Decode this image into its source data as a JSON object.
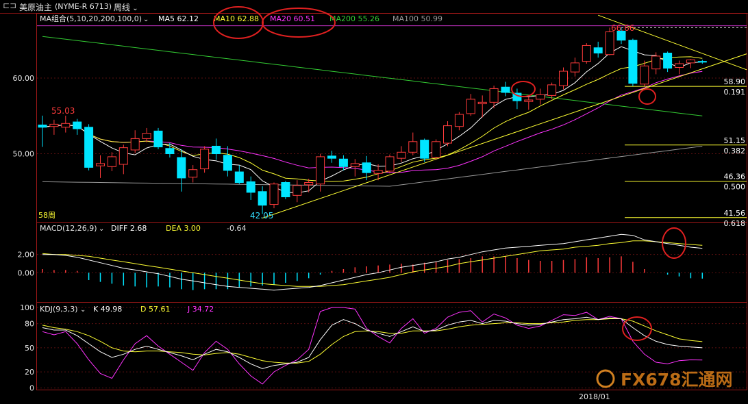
{
  "title": {
    "icon": "split-window-icon",
    "name": "美原油主",
    "code": "(NYME-R 6713)",
    "period": "周线"
  },
  "colors": {
    "up": "#ff3b3b",
    "down": "#00e5ff",
    "ma5": "#ffffff",
    "ma10": "#ffff33",
    "ma20": "#ff33ff",
    "ma200": "#33cc33",
    "ma100": "#999999",
    "frame": "#a01818"
  },
  "legend": {
    "ma_group": "MA组合(5,10,20,200,100,0)",
    "ma5": "MA5 62.12",
    "ma10": "MA10 62.88",
    "ma20": "MA20 60.51",
    "ma200": "MA200 55.26",
    "ma100": "MA100 50.99",
    "macd_group": "MACD(12,26,9)",
    "macd_diff": "DIFF  2.68",
    "macd_dea": "DEA  3.00",
    "macd_val": "-0.64",
    "kdj_group": "KDJ(9,3,3)",
    "kdj_k": "K  49.98",
    "kdj_d": "D  57.61",
    "kdj_j": "J  34.72"
  },
  "annotations": {
    "high": "66.66",
    "first_high": "55.03",
    "low": "42.05",
    "bars": "58周",
    "date": "2018/01"
  },
  "watermark": "FX678汇通网",
  "chart_data": [
    {
      "type": "candlestick",
      "panel": "price",
      "y_ticks": [
        "60.00",
        "50.00"
      ],
      "ylim": [
        41,
        68.5
      ],
      "x_count": 58,
      "candles": [
        {
          "o": 53.8,
          "h": 55.03,
          "l": 50.9,
          "c": 53.5
        },
        {
          "o": 53.6,
          "h": 54.5,
          "l": 52.5,
          "c": 53.9
        },
        {
          "o": 53.5,
          "h": 55.03,
          "l": 52.8,
          "c": 54.0
        },
        {
          "o": 54.2,
          "h": 54.6,
          "l": 52.5,
          "c": 53.3
        },
        {
          "o": 53.5,
          "h": 53.9,
          "l": 47.8,
          "c": 48.2
        },
        {
          "o": 48.4,
          "h": 49.8,
          "l": 46.8,
          "c": 48.7
        },
        {
          "o": 48.3,
          "h": 50.2,
          "l": 47.7,
          "c": 49.6
        },
        {
          "o": 48.6,
          "h": 51.2,
          "l": 47.3,
          "c": 50.8
        },
        {
          "o": 50.5,
          "h": 53.1,
          "l": 50.1,
          "c": 52.0
        },
        {
          "o": 52.0,
          "h": 53.4,
          "l": 51.5,
          "c": 52.7
        },
        {
          "o": 53.0,
          "h": 53.4,
          "l": 50.6,
          "c": 50.9
        },
        {
          "o": 50.7,
          "h": 51.4,
          "l": 49.5,
          "c": 50.0
        },
        {
          "o": 49.5,
          "h": 50.6,
          "l": 45.0,
          "c": 46.8
        },
        {
          "o": 46.9,
          "h": 48.5,
          "l": 46.2,
          "c": 47.9
        },
        {
          "o": 48.0,
          "h": 51.0,
          "l": 47.5,
          "c": 50.6
        },
        {
          "o": 51.0,
          "h": 52.0,
          "l": 49.2,
          "c": 50.0
        },
        {
          "o": 49.8,
          "h": 51.0,
          "l": 47.0,
          "c": 47.8
        },
        {
          "o": 47.6,
          "h": 48.5,
          "l": 46.0,
          "c": 46.2
        },
        {
          "o": 46.3,
          "h": 47.0,
          "l": 43.9,
          "c": 44.9
        },
        {
          "o": 45.0,
          "h": 45.7,
          "l": 42.05,
          "c": 43.2
        },
        {
          "o": 43.3,
          "h": 46.2,
          "l": 42.8,
          "c": 46.0
        },
        {
          "o": 46.2,
          "h": 46.4,
          "l": 44.0,
          "c": 44.3
        },
        {
          "o": 44.5,
          "h": 46.5,
          "l": 43.6,
          "c": 45.8
        },
        {
          "o": 45.9,
          "h": 46.7,
          "l": 44.9,
          "c": 46.2
        },
        {
          "o": 46.0,
          "h": 50.0,
          "l": 45.0,
          "c": 49.6
        },
        {
          "o": 49.7,
          "h": 50.4,
          "l": 48.8,
          "c": 49.4
        },
        {
          "o": 49.3,
          "h": 49.8,
          "l": 47.8,
          "c": 48.3
        },
        {
          "o": 48.3,
          "h": 49.3,
          "l": 47.0,
          "c": 48.7
        },
        {
          "o": 48.8,
          "h": 49.7,
          "l": 46.5,
          "c": 47.5
        },
        {
          "o": 47.4,
          "h": 48.6,
          "l": 46.5,
          "c": 47.8
        },
        {
          "o": 47.7,
          "h": 49.9,
          "l": 47.4,
          "c": 49.6
        },
        {
          "o": 49.4,
          "h": 51.0,
          "l": 48.9,
          "c": 50.2
        },
        {
          "o": 50.2,
          "h": 52.8,
          "l": 49.8,
          "c": 51.6
        },
        {
          "o": 51.8,
          "h": 52.0,
          "l": 48.9,
          "c": 49.4
        },
        {
          "o": 49.5,
          "h": 51.9,
          "l": 49.2,
          "c": 51.6
        },
        {
          "o": 51.4,
          "h": 54.3,
          "l": 51.0,
          "c": 53.7
        },
        {
          "o": 53.6,
          "h": 55.5,
          "l": 53.1,
          "c": 55.2
        },
        {
          "o": 55.3,
          "h": 57.9,
          "l": 55.0,
          "c": 57.2
        },
        {
          "o": 56.6,
          "h": 57.7,
          "l": 54.8,
          "c": 56.8
        },
        {
          "o": 56.8,
          "h": 59.0,
          "l": 56.0,
          "c": 58.6
        },
        {
          "o": 58.8,
          "h": 59.5,
          "l": 57.6,
          "c": 58.1
        },
        {
          "o": 58.0,
          "h": 58.6,
          "l": 55.9,
          "c": 57.0
        },
        {
          "o": 56.9,
          "h": 57.5,
          "l": 55.8,
          "c": 57.1
        },
        {
          "o": 57.2,
          "h": 58.6,
          "l": 56.5,
          "c": 57.8
        },
        {
          "o": 57.7,
          "h": 59.4,
          "l": 57.2,
          "c": 59.1
        },
        {
          "o": 59.0,
          "h": 61.4,
          "l": 58.5,
          "c": 60.9
        },
        {
          "o": 60.8,
          "h": 62.7,
          "l": 60.2,
          "c": 62.0
        },
        {
          "o": 62.2,
          "h": 64.6,
          "l": 61.9,
          "c": 64.3
        },
        {
          "o": 64.0,
          "h": 64.8,
          "l": 62.7,
          "c": 63.3
        },
        {
          "o": 63.1,
          "h": 66.66,
          "l": 63.0,
          "c": 66.1
        },
        {
          "o": 66.2,
          "h": 66.66,
          "l": 64.5,
          "c": 65.0
        },
        {
          "o": 65.0,
          "h": 65.2,
          "l": 58.9,
          "c": 59.3
        },
        {
          "o": 59.2,
          "h": 62.3,
          "l": 58.9,
          "c": 61.6
        },
        {
          "o": 61.2,
          "h": 63.4,
          "l": 60.5,
          "c": 62.9
        },
        {
          "o": 63.3,
          "h": 63.5,
          "l": 60.8,
          "c": 61.3
        },
        {
          "o": 61.4,
          "h": 62.3,
          "l": 60.5,
          "c": 61.9
        },
        {
          "o": 62.0,
          "h": 62.5,
          "l": 61.3,
          "c": 62.4
        },
        {
          "o": 62.2,
          "h": 62.4,
          "l": 61.9,
          "c": 62.1
        }
      ],
      "fib_levels": [
        {
          "price": "58.90",
          "ratio": "0.191"
        },
        {
          "price": "51.15",
          "ratio": "0.382"
        },
        {
          "price": "46.36",
          "ratio": "0.500"
        },
        {
          "price": "41.56",
          "ratio": "0.618"
        }
      ],
      "fib_values": [
        58.9,
        51.15,
        46.36,
        41.56
      ],
      "resistance_line": 66.9
    },
    {
      "type": "line",
      "panel": "macd",
      "y_ticks": [
        "2.00",
        "0.00"
      ],
      "ylim": [
        -3.2,
        5.5
      ],
      "diff": [
        2.0,
        2.0,
        1.9,
        1.7,
        1.4,
        1.1,
        0.8,
        0.5,
        0.3,
        0.1,
        -0.1,
        -0.4,
        -0.7,
        -0.9,
        -1.1,
        -1.3,
        -1.5,
        -1.6,
        -1.7,
        -1.8,
        -1.9,
        -1.8,
        -1.7,
        -1.6,
        -1.4,
        -1.1,
        -0.8,
        -0.5,
        -0.2,
        0.0,
        0.3,
        0.6,
        0.8,
        1.0,
        1.2,
        1.5,
        1.7,
        2.0,
        2.3,
        2.5,
        2.7,
        2.8,
        2.9,
        3.0,
        3.1,
        3.2,
        3.4,
        3.6,
        3.8,
        4.0,
        4.2,
        4.1,
        3.6,
        3.4,
        3.2,
        3.0,
        2.8,
        2.68
      ],
      "dea": [
        2.1,
        2.0,
        2.0,
        1.9,
        1.8,
        1.6,
        1.4,
        1.2,
        1.0,
        0.8,
        0.6,
        0.4,
        0.2,
        0.0,
        -0.2,
        -0.4,
        -0.6,
        -0.8,
        -1.0,
        -1.2,
        -1.3,
        -1.4,
        -1.5,
        -1.5,
        -1.5,
        -1.4,
        -1.3,
        -1.1,
        -0.9,
        -0.7,
        -0.5,
        -0.2,
        0.1,
        0.3,
        0.5,
        0.7,
        1.0,
        1.2,
        1.4,
        1.6,
        1.8,
        2.0,
        2.2,
        2.4,
        2.5,
        2.6,
        2.8,
        2.9,
        3.0,
        3.2,
        3.3,
        3.5,
        3.5,
        3.4,
        3.3,
        3.2,
        3.1,
        3.0
      ],
      "hist": [
        0.4,
        0.3,
        0.3,
        0.2,
        -0.8,
        -1.0,
        -1.2,
        -1.4,
        -1.5,
        -1.6,
        -1.5,
        -1.6,
        -1.8,
        -1.9,
        -1.8,
        -1.8,
        -1.8,
        -1.6,
        -1.5,
        -1.4,
        -1.3,
        -1.1,
        -0.9,
        -0.6,
        -0.2,
        0.2,
        0.4,
        0.6,
        0.7,
        0.8,
        0.9,
        1.0,
        0.9,
        1.1,
        1.2,
        1.4,
        1.5,
        1.6,
        1.8,
        1.8,
        1.8,
        1.6,
        1.4,
        1.3,
        1.3,
        1.4,
        1.5,
        1.7,
        1.6,
        1.7,
        1.8,
        1.2,
        0.4,
        0.0,
        -0.2,
        -0.4,
        -0.6,
        -0.64
      ]
    },
    {
      "type": "line",
      "panel": "kdj",
      "y_ticks": [
        "100",
        "80",
        "50",
        "20",
        "0"
      ],
      "ylim": [
        -2,
        106
      ],
      "k": [
        75,
        72,
        72,
        65,
        55,
        45,
        38,
        42,
        48,
        52,
        48,
        44,
        40,
        35,
        42,
        48,
        45,
        38,
        30,
        24,
        28,
        30,
        32,
        38,
        60,
        78,
        85,
        80,
        72,
        68,
        64,
        70,
        76,
        70,
        72,
        78,
        82,
        84,
        80,
        84,
        83,
        80,
        78,
        79,
        82,
        85,
        86,
        88,
        85,
        87,
        86,
        75,
        65,
        58,
        54,
        52,
        51,
        49.98
      ],
      "d": [
        78,
        75,
        73,
        70,
        65,
        58,
        50,
        46,
        45,
        46,
        46,
        45,
        44,
        42,
        41,
        43,
        44,
        42,
        38,
        34,
        32,
        31,
        31,
        33,
        42,
        54,
        64,
        70,
        71,
        70,
        68,
        68,
        71,
        71,
        71,
        73,
        76,
        78,
        79,
        80,
        81,
        81,
        80,
        80,
        81,
        82,
        84,
        85,
        85,
        86,
        86,
        83,
        77,
        71,
        66,
        61,
        59,
        57.61
      ],
      "j": [
        70,
        66,
        70,
        55,
        35,
        18,
        12,
        35,
        55,
        65,
        52,
        42,
        32,
        22,
        44,
        58,
        48,
        30,
        15,
        5,
        20,
        28,
        35,
        48,
        95,
        100,
        100,
        98,
        74,
        64,
        56,
        74,
        86,
        68,
        74,
        88,
        94,
        96,
        82,
        92,
        87,
        78,
        74,
        77,
        84,
        91,
        90,
        94,
        85,
        89,
        86,
        58,
        42,
        32,
        30,
        34,
        35,
        34.72
      ]
    }
  ]
}
